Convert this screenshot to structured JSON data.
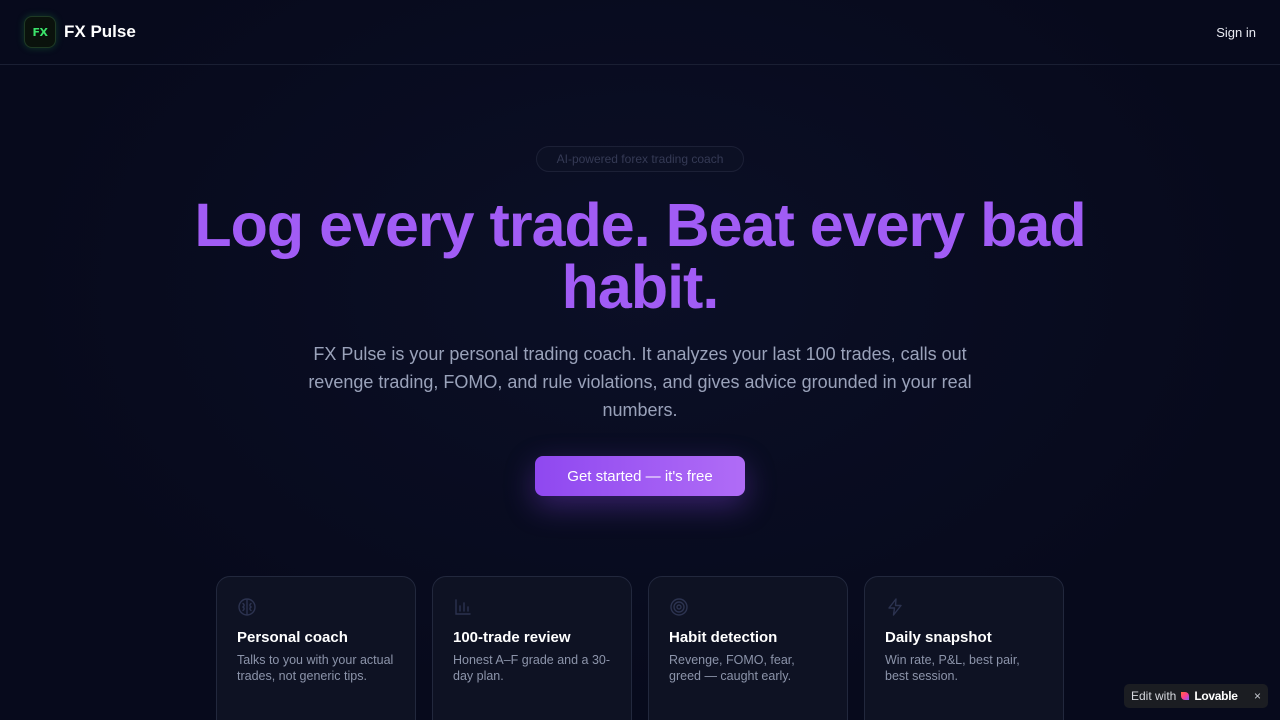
{
  "header": {
    "logo_text": "FX",
    "brand_name": "FX Pulse",
    "signin_label": "Sign in"
  },
  "hero": {
    "badge": "AI-powered forex trading coach",
    "headline": "Log every trade. Beat every bad habit.",
    "subtitle": "FX Pulse is your personal trading coach. It analyzes your last 100 trades, calls out revenge trading, FOMO, and rule violations, and gives advice grounded in your real numbers.",
    "cta_label": "Get started — it's free"
  },
  "features": [
    {
      "icon": "brain-icon",
      "title": "Personal coach",
      "text": "Talks to you with your actual trades, not generic tips."
    },
    {
      "icon": "bar-chart-icon",
      "title": "100-trade review",
      "text": "Honest A–F grade and a 30-day plan."
    },
    {
      "icon": "target-icon",
      "title": "Habit detection",
      "text": "Revenge, FOMO, fear, greed — caught early."
    },
    {
      "icon": "lightning-icon",
      "title": "Daily snapshot",
      "text": "Win rate, P&L, best pair, best session."
    }
  ],
  "lovable_badge": {
    "prefix": "Edit with",
    "brand": "Lovable",
    "close": "×"
  },
  "colors": {
    "background": "#070a1c",
    "accent": "#a15cf5",
    "logo_green": "#3be36a"
  }
}
